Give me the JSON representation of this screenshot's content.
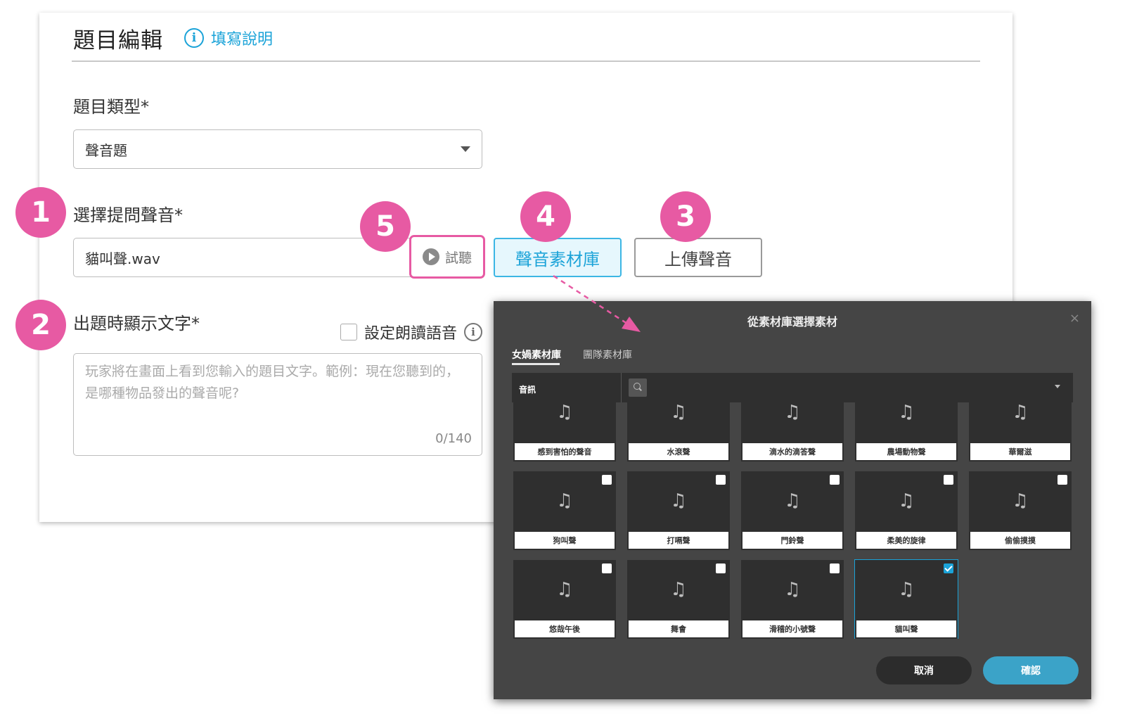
{
  "editor": {
    "title": "題目編輯",
    "help_link": "填寫說明",
    "help_icon_glyph": "i",
    "question_type": {
      "label": "題目類型*",
      "value": "聲音題"
    },
    "prompt_sound": {
      "label": "選擇提問聲音*",
      "value": "貓叫聲.wav",
      "preview_label": "試聽",
      "library_label": "聲音素材庫",
      "upload_label": "上傳聲音"
    },
    "display_text": {
      "label": "出題時顯示文字*",
      "tts_label": "設定朗讀語音",
      "tts_info_glyph": "i",
      "placeholder": "玩家將在畫面上看到您輸入的題目文字。範例：現在您聽到的，是哪種物品發出的聲音呢?",
      "counter": "0/140"
    }
  },
  "steps": [
    "1",
    "2",
    "3",
    "4",
    "5"
  ],
  "dialog": {
    "title": "從素材庫選擇素材",
    "close_glyph": "×",
    "tabs": [
      "女媧素材庫",
      "團隊素材庫"
    ],
    "category": "音訊",
    "music_glyph": "♫",
    "assets": [
      {
        "name": "感到害怕的聲音",
        "checkbox": false,
        "checked": false
      },
      {
        "name": "水滾聲",
        "checkbox": false,
        "checked": false
      },
      {
        "name": "滴水的滴答聲",
        "checkbox": false,
        "checked": false
      },
      {
        "name": "農場動物聲",
        "checkbox": false,
        "checked": false
      },
      {
        "name": "華爾滋",
        "checkbox": false,
        "checked": false
      },
      {
        "name": "狗叫聲",
        "checkbox": true,
        "checked": false
      },
      {
        "name": "打嗝聲",
        "checkbox": true,
        "checked": false
      },
      {
        "name": "門鈴聲",
        "checkbox": true,
        "checked": false
      },
      {
        "name": "柔美的旋律",
        "checkbox": true,
        "checked": false
      },
      {
        "name": "偷偷摸摸",
        "checkbox": true,
        "checked": false
      },
      {
        "name": "悠哉午後",
        "checkbox": true,
        "checked": false
      },
      {
        "name": "舞會",
        "checkbox": true,
        "checked": false
      },
      {
        "name": "滑稽的小號聲",
        "checkbox": true,
        "checked": false
      },
      {
        "name": "貓叫聲",
        "checkbox": true,
        "checked": true
      }
    ],
    "cancel_label": "取消",
    "confirm_label": "確認"
  },
  "colors": {
    "accent_blue": "#1ba3d8",
    "annotation_pink": "#e75aa3",
    "dialog_bg": "#454545",
    "confirm_button": "#3ba3c8"
  }
}
